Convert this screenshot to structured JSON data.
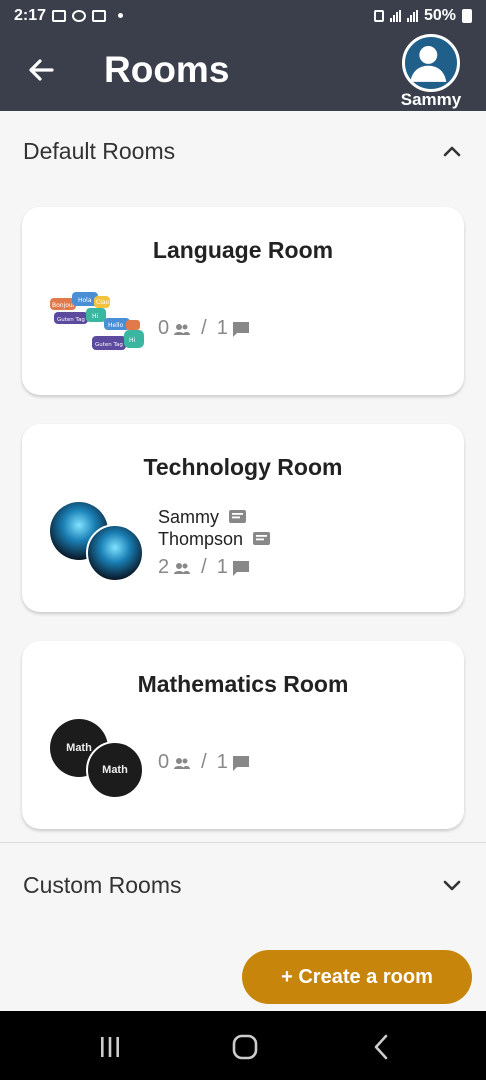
{
  "status_bar": {
    "time": "2:17",
    "battery": "50%"
  },
  "app_bar": {
    "title": "Rooms",
    "user_name": "Sammy"
  },
  "sections": {
    "default": {
      "label": "Default Rooms"
    },
    "custom": {
      "label": "Custom Rooms"
    }
  },
  "rooms": [
    {
      "title": "Language Room",
      "count": "0",
      "sep": "/",
      "messages": "1"
    },
    {
      "title": "Technology Room",
      "members": [
        "Sammy",
        "Thompson"
      ],
      "count": "2",
      "sep": "/",
      "messages": "1"
    },
    {
      "title": "Mathematics Room",
      "count": "0",
      "sep": "/",
      "messages": "1"
    }
  ],
  "create_button": "+ Create a room",
  "colors": {
    "header": "#3a3f4b",
    "accent": "#c7860b",
    "avatar": "#1f5f8a"
  },
  "thumbnail_labels": {
    "language_bubbles": [
      "Hola",
      "Hello",
      "Bonjour",
      "Ciao",
      "Guten Tag",
      "Hi"
    ],
    "math": "Math"
  }
}
